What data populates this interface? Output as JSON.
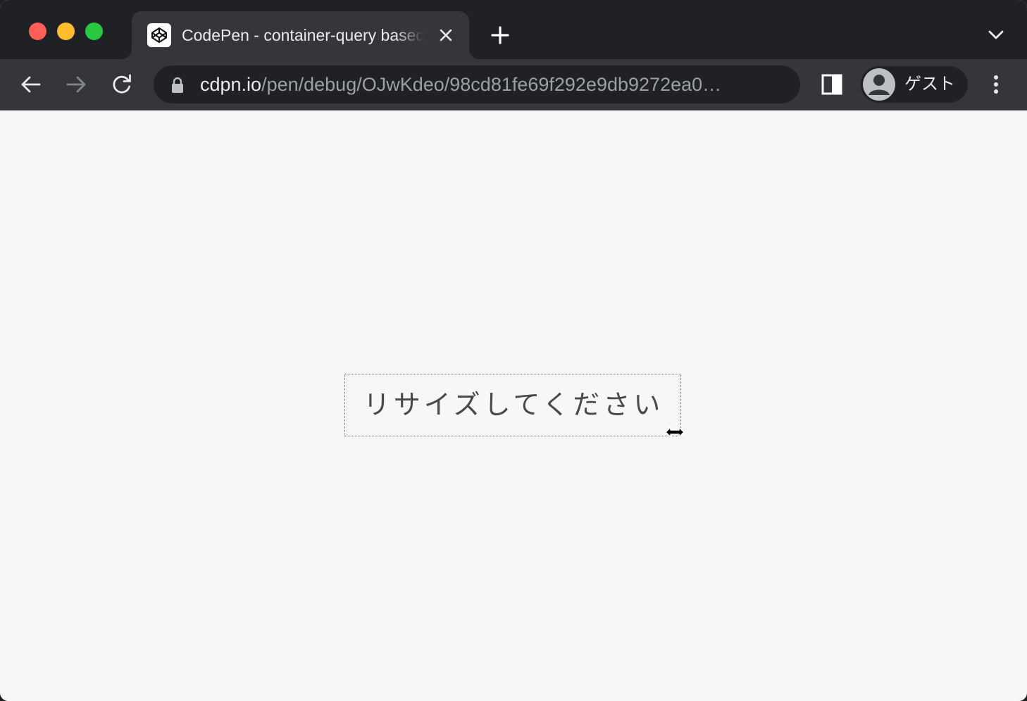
{
  "browser": {
    "tab": {
      "title": "CodePen - container-query based resize",
      "favicon": "codepen-icon"
    },
    "address_bar": {
      "host": "cdpn.io",
      "path": "/pen/debug/OJwKdeo/98cd81fe69f292e9db9272ea0…",
      "lock": "lock-icon"
    },
    "profile": {
      "label": "ゲスト"
    },
    "colors": {
      "tabstrip": "#202124",
      "toolbar": "#35363a",
      "content_bg": "#f7f7f7",
      "close": "#ff5f57",
      "minimize": "#febc2e",
      "maximize": "#28c840"
    }
  },
  "page": {
    "resize_box": {
      "text": "リサイズしてください"
    },
    "cursor": "resize-horizontal-cursor-icon"
  }
}
